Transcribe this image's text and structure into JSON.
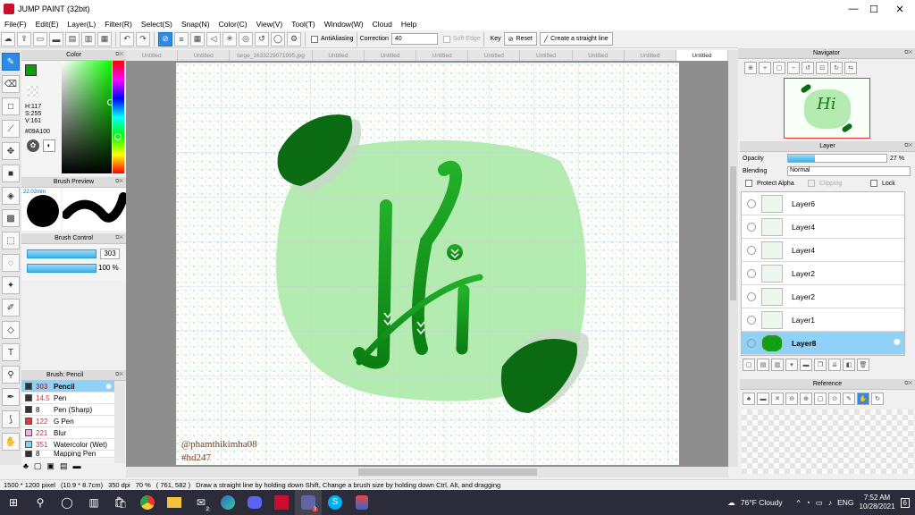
{
  "window": {
    "title": "JUMP PAINT (32bit)",
    "minimize": "—",
    "maximize": "☐",
    "close": "✕"
  },
  "menu": [
    "File(F)",
    "Edit(E)",
    "Layer(L)",
    "Filter(R)",
    "Select(S)",
    "Snap(N)",
    "Color(C)",
    "View(V)",
    "Tool(T)",
    "Window(W)",
    "Cloud",
    "Help"
  ],
  "toolbar": {
    "antialiasing_label": "AntiAliasing",
    "correction_label": "Correction",
    "correction_value": "40",
    "soft_edge_label": "Soft Edge",
    "key_label": "Key",
    "reset_label": "Reset",
    "straight_line_label": "Create a straight line"
  },
  "color_panel": {
    "title": "Color",
    "h": "H:117",
    "s": "S:255",
    "v": "V:161",
    "hex": "#09A100",
    "current_color": "#09A100"
  },
  "brush_preview": {
    "title": "Brush Preview",
    "size": "22.02mm"
  },
  "brush_control": {
    "title": "Brush Control",
    "size_value": "303",
    "opacity_value": "100 %"
  },
  "brush_list": {
    "title": "Brush: Pencil",
    "items": [
      {
        "size": "303",
        "name": "Pencil",
        "color": "#333333",
        "selected": true
      },
      {
        "size": "14.5",
        "name": "Pen",
        "color": "#333333",
        "selected": false
      },
      {
        "size": "8",
        "name": "Pen (Sharp)",
        "color": "#333333",
        "selected": false
      },
      {
        "size": "122",
        "name": "G Pen",
        "color": "#ee3333",
        "selected": false
      },
      {
        "size": "221",
        "name": "Blur",
        "color": "#f3a9f3",
        "selected": false
      },
      {
        "size": "351",
        "name": "Watercolor (Wet)",
        "color": "#7fd8f3",
        "selected": false
      },
      {
        "size": "8",
        "name": "Mapping Pen",
        "color": "#333333",
        "selected": false
      }
    ]
  },
  "doc_tabs": [
    "Untitled",
    "Untitled",
    "large_1633229071995.jpg",
    "Untitled",
    "Untitled",
    "Untitled",
    "Untitled",
    "Untitled",
    "Untitled",
    "Untitled",
    "Untitled"
  ],
  "canvas": {
    "letters": "Hi",
    "credit": "@phamthikimha08",
    "tag": "#hd247"
  },
  "navigator": {
    "title": "Navigator"
  },
  "layer_panel": {
    "title": "Layer",
    "opacity_label": "Opacity",
    "opacity_value": "27 %",
    "opacity_fraction": 0.27,
    "blending_label": "Blending",
    "blending_value": "Normal",
    "protect_alpha": "Protect Alpha",
    "clipping": "Clipping",
    "lock": "Lock",
    "layers": [
      {
        "name": "Layer6",
        "selected": false
      },
      {
        "name": "Layer4",
        "selected": false
      },
      {
        "name": "Layer4",
        "selected": false
      },
      {
        "name": "Layer2",
        "selected": false
      },
      {
        "name": "Layer2",
        "selected": false
      },
      {
        "name": "Layer1",
        "selected": false
      },
      {
        "name": "Layer8",
        "selected": true
      }
    ]
  },
  "reference": {
    "title": "Reference"
  },
  "status": {
    "size": "1500 * 1200 pixel",
    "cm": "(10.9 * 8.7cm)",
    "dpi": "350 dpi",
    "zoom": "70 %",
    "coords": "( 761, 582 )",
    "hint": "Draw a straight line by holding down Shift, Change a brush size by holding down Ctrl, Alt, and dragging"
  },
  "taskbar": {
    "weather": "76°F  Cloudy",
    "lang": "ENG",
    "time": "7:52 AM",
    "date": "10/28/2021",
    "notif": "6",
    "mail_badge": "2",
    "teams_badge": "3"
  }
}
